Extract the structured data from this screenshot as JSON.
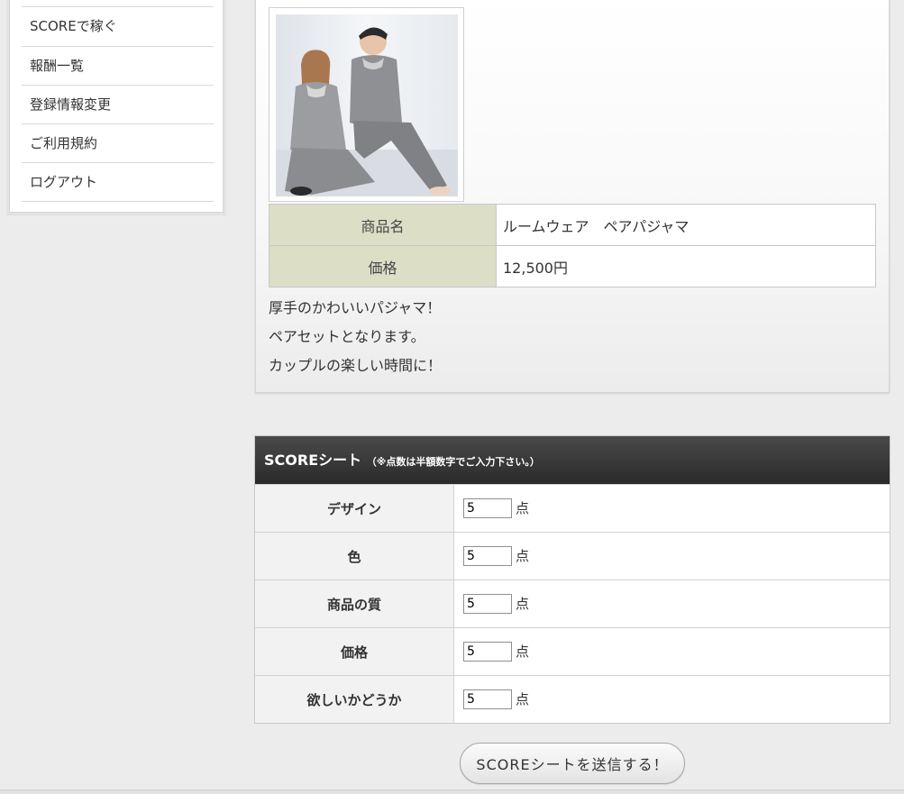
{
  "sidebar": {
    "items": [
      {
        "label": "SCOREで稼ぐ"
      },
      {
        "label": "報酬一覧"
      },
      {
        "label": "登録情報変更"
      },
      {
        "label": "ご利用規約"
      },
      {
        "label": "ログアウト"
      }
    ]
  },
  "product": {
    "image_icon": "product-photo-pajama-couple",
    "name_label": "商品名",
    "name_value": "ルームウェア　ペアパジャマ",
    "price_label": "価格",
    "price_value": "12,500円",
    "description": [
      "厚手のかわいいパジャマ！",
      "ペアセットとなります。",
      "カップルの楽しい時間に！"
    ]
  },
  "score_sheet": {
    "title": "SCOREシート",
    "note": "（※点数は半額数字でご入力下さい。）",
    "unit": "点",
    "rows": [
      {
        "label": "デザイン",
        "value": "5"
      },
      {
        "label": "色",
        "value": "5"
      },
      {
        "label": "商品の質",
        "value": "5"
      },
      {
        "label": "価格",
        "value": "5"
      },
      {
        "label": "欲しいかどうか",
        "value": "5"
      }
    ],
    "submit_label": "SCOREシートを送信する！"
  },
  "colors": {
    "label_cell_bg": "#dcdfc6",
    "header_bg": "#333333"
  }
}
